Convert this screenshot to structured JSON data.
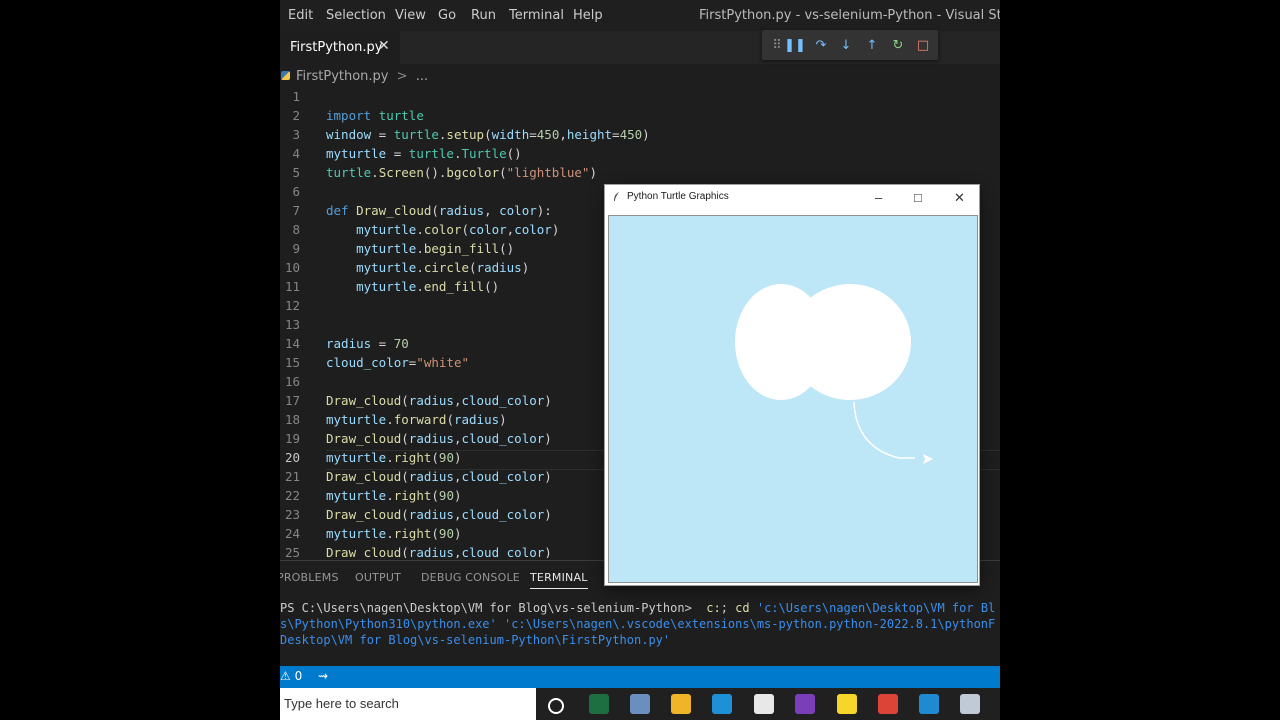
{
  "menu": [
    "Edit",
    "Selection",
    "View",
    "Go",
    "Run",
    "Terminal",
    "Help"
  ],
  "window_title": "FirstPython.py - vs-selenium-Python - Visual Studio Code",
  "tab": {
    "label": "FirstPython.py",
    "close": "✕"
  },
  "breadcrumb": {
    "file": "FirstPython.py",
    "sep": ">",
    "more": "..."
  },
  "debug_toolbar": [
    {
      "icon": "drag-handle-icon",
      "glyph": "⠿",
      "color": "#8a8a8a"
    },
    {
      "icon": "pause-icon",
      "glyph": "❚❚",
      "color": "#75beff"
    },
    {
      "icon": "step-over-icon",
      "glyph": "↷",
      "color": "#75beff"
    },
    {
      "icon": "step-into-icon",
      "glyph": "↓",
      "color": "#75beff"
    },
    {
      "icon": "step-out-icon",
      "glyph": "↑",
      "color": "#75beff"
    },
    {
      "icon": "restart-icon",
      "glyph": "↻",
      "color": "#89d185"
    },
    {
      "icon": "stop-icon",
      "glyph": "□",
      "color": "#f48771"
    }
  ],
  "editor": {
    "active_line": 20,
    "lines": [
      {
        "n": "1",
        "tokens": []
      },
      {
        "n": "2",
        "tokens": [
          [
            "kw",
            "import "
          ],
          [
            "cls",
            "turtle"
          ]
        ]
      },
      {
        "n": "3",
        "tokens": [
          [
            "var",
            "window"
          ],
          [
            "plain",
            " = "
          ],
          [
            "cls",
            "turtle"
          ],
          [
            "plain",
            "."
          ],
          [
            "fn",
            "setup"
          ],
          [
            "plain",
            "("
          ],
          [
            "var",
            "width"
          ],
          [
            "plain",
            "="
          ],
          [
            "num",
            "450"
          ],
          [
            "plain",
            ","
          ],
          [
            "var",
            "height"
          ],
          [
            "plain",
            "="
          ],
          [
            "num",
            "450"
          ],
          [
            "plain",
            ")"
          ]
        ]
      },
      {
        "n": "4",
        "tokens": [
          [
            "var",
            "myturtle"
          ],
          [
            "plain",
            " = "
          ],
          [
            "cls",
            "turtle"
          ],
          [
            "plain",
            "."
          ],
          [
            "cls",
            "Turtle"
          ],
          [
            "plain",
            "()"
          ]
        ]
      },
      {
        "n": "5",
        "tokens": [
          [
            "cls",
            "turtle"
          ],
          [
            "plain",
            "."
          ],
          [
            "fn",
            "Screen"
          ],
          [
            "plain",
            "()."
          ],
          [
            "fn",
            "bgcolor"
          ],
          [
            "plain",
            "("
          ],
          [
            "str",
            "\"lightblue\""
          ],
          [
            "plain",
            ")"
          ]
        ]
      },
      {
        "n": "6",
        "tokens": []
      },
      {
        "n": "7",
        "tokens": [
          [
            "kw",
            "def "
          ],
          [
            "fn",
            "Draw_cloud"
          ],
          [
            "plain",
            "("
          ],
          [
            "var",
            "radius"
          ],
          [
            "plain",
            ", "
          ],
          [
            "var",
            "color"
          ],
          [
            "plain",
            "):"
          ]
        ]
      },
      {
        "n": "8",
        "tokens": [
          [
            "plain",
            "    "
          ],
          [
            "var",
            "myturtle"
          ],
          [
            "plain",
            "."
          ],
          [
            "fn",
            "color"
          ],
          [
            "plain",
            "("
          ],
          [
            "var",
            "color"
          ],
          [
            "plain",
            ","
          ],
          [
            "var",
            "color"
          ],
          [
            "plain",
            ")"
          ]
        ]
      },
      {
        "n": "9",
        "tokens": [
          [
            "plain",
            "    "
          ],
          [
            "var",
            "myturtle"
          ],
          [
            "plain",
            "."
          ],
          [
            "fn",
            "begin_fill"
          ],
          [
            "plain",
            "()"
          ]
        ]
      },
      {
        "n": "10",
        "tokens": [
          [
            "plain",
            "    "
          ],
          [
            "var",
            "myturtle"
          ],
          [
            "plain",
            "."
          ],
          [
            "fn",
            "circle"
          ],
          [
            "plain",
            "("
          ],
          [
            "var",
            "radius"
          ],
          [
            "plain",
            ")"
          ]
        ]
      },
      {
        "n": "11",
        "tokens": [
          [
            "plain",
            "    "
          ],
          [
            "var",
            "myturtle"
          ],
          [
            "plain",
            "."
          ],
          [
            "fn",
            "end_fill"
          ],
          [
            "plain",
            "()"
          ]
        ]
      },
      {
        "n": "12",
        "tokens": []
      },
      {
        "n": "13",
        "tokens": []
      },
      {
        "n": "14",
        "tokens": [
          [
            "var",
            "radius"
          ],
          [
            "plain",
            " = "
          ],
          [
            "num",
            "70"
          ]
        ]
      },
      {
        "n": "15",
        "tokens": [
          [
            "var",
            "cloud_color"
          ],
          [
            "plain",
            "="
          ],
          [
            "str",
            "\"white\""
          ]
        ]
      },
      {
        "n": "16",
        "tokens": []
      },
      {
        "n": "17",
        "tokens": [
          [
            "fn",
            "Draw_cloud"
          ],
          [
            "plain",
            "("
          ],
          [
            "var",
            "radius"
          ],
          [
            "plain",
            ","
          ],
          [
            "var",
            "cloud_color"
          ],
          [
            "plain",
            ")"
          ]
        ]
      },
      {
        "n": "18",
        "tokens": [
          [
            "var",
            "myturtle"
          ],
          [
            "plain",
            "."
          ],
          [
            "fn",
            "forward"
          ],
          [
            "plain",
            "("
          ],
          [
            "var",
            "radius"
          ],
          [
            "plain",
            ")"
          ]
        ]
      },
      {
        "n": "19",
        "tokens": [
          [
            "fn",
            "Draw_cloud"
          ],
          [
            "plain",
            "("
          ],
          [
            "var",
            "radius"
          ],
          [
            "plain",
            ","
          ],
          [
            "var",
            "cloud_color"
          ],
          [
            "plain",
            ")"
          ]
        ]
      },
      {
        "n": "20",
        "tokens": [
          [
            "var",
            "myturtle"
          ],
          [
            "plain",
            "."
          ],
          [
            "fn",
            "right"
          ],
          [
            "plain",
            "("
          ],
          [
            "num",
            "90"
          ],
          [
            "plain",
            ")"
          ]
        ]
      },
      {
        "n": "21",
        "tokens": [
          [
            "fn",
            "Draw_cloud"
          ],
          [
            "plain",
            "("
          ],
          [
            "var",
            "radius"
          ],
          [
            "plain",
            ","
          ],
          [
            "var",
            "cloud_color"
          ],
          [
            "plain",
            ")"
          ]
        ]
      },
      {
        "n": "22",
        "tokens": [
          [
            "var",
            "myturtle"
          ],
          [
            "plain",
            "."
          ],
          [
            "fn",
            "right"
          ],
          [
            "plain",
            "("
          ],
          [
            "num",
            "90"
          ],
          [
            "plain",
            ")"
          ]
        ]
      },
      {
        "n": "23",
        "tokens": [
          [
            "fn",
            "Draw_cloud"
          ],
          [
            "plain",
            "("
          ],
          [
            "var",
            "radius"
          ],
          [
            "plain",
            ","
          ],
          [
            "var",
            "cloud_color"
          ],
          [
            "plain",
            ")"
          ]
        ]
      },
      {
        "n": "24",
        "tokens": [
          [
            "var",
            "myturtle"
          ],
          [
            "plain",
            "."
          ],
          [
            "fn",
            "right"
          ],
          [
            "plain",
            "("
          ],
          [
            "num",
            "90"
          ],
          [
            "plain",
            ")"
          ]
        ]
      },
      {
        "n": "25",
        "tokens": [
          [
            "fn",
            "Draw_cloud"
          ],
          [
            "plain",
            "("
          ],
          [
            "var",
            "radius"
          ],
          [
            "plain",
            ","
          ],
          [
            "var",
            "cloud_color"
          ],
          [
            "plain",
            ")"
          ]
        ]
      }
    ]
  },
  "panel": {
    "tabs": [
      {
        "label": "PROBLEMS",
        "active": false
      },
      {
        "label": "OUTPUT",
        "active": false
      },
      {
        "label": "DEBUG CONSOLE",
        "active": false
      },
      {
        "label": "TERMINAL",
        "active": true
      }
    ],
    "terminal": [
      [
        [
          "#cccccc",
          "PS C:\\Users\\nagen\\Desktop\\VM for Blog\\vs-selenium-Python>  "
        ],
        [
          "#dcdcaa",
          "c:"
        ],
        [
          "#cccccc",
          "; "
        ],
        [
          "#dcdcaa",
          "cd "
        ],
        [
          "#3b8eea",
          "'c:\\Users\\nagen\\Desktop\\VM for Bl"
        ]
      ],
      [
        [
          "#3b8eea",
          "s\\Python\\Python310\\python.exe' 'c:\\Users\\nagen\\.vscode\\extensions\\ms-python.python-2022.8.1\\pythonF"
        ]
      ],
      [
        [
          "#3b8eea",
          "Desktop\\VM for Blog\\vs-selenium-Python\\FirstPython.py'"
        ]
      ]
    ]
  },
  "statusbar": {
    "problems": "0"
  },
  "taskbar": {
    "search_placeholder": "Type here to search",
    "icons": [
      {
        "name": "cortana-icon",
        "color": "#202020"
      },
      {
        "name": "excel-icon",
        "color": "#1d6f42"
      },
      {
        "name": "paint-icon",
        "color": "#6a8fbf"
      },
      {
        "name": "file-explorer-icon",
        "color": "#f0b429"
      },
      {
        "name": "edge-icon",
        "color": "#1e90d6"
      },
      {
        "name": "notepad-icon",
        "color": "#e8e8e8"
      },
      {
        "name": "visual-studio-icon",
        "color": "#7a3fb8"
      },
      {
        "name": "sticky-notes-icon",
        "color": "#f6d62a"
      },
      {
        "name": "chrome-icon",
        "color": "#db4437"
      },
      {
        "name": "vscode-icon",
        "color": "#1f8ad2"
      },
      {
        "name": "python-tool-icon",
        "color": "#bfcad6"
      }
    ]
  },
  "turtle_window": {
    "title": "Python Turtle Graphics",
    "canvas_bg": "#bde6f6",
    "cloud_color": "#ffffff"
  }
}
